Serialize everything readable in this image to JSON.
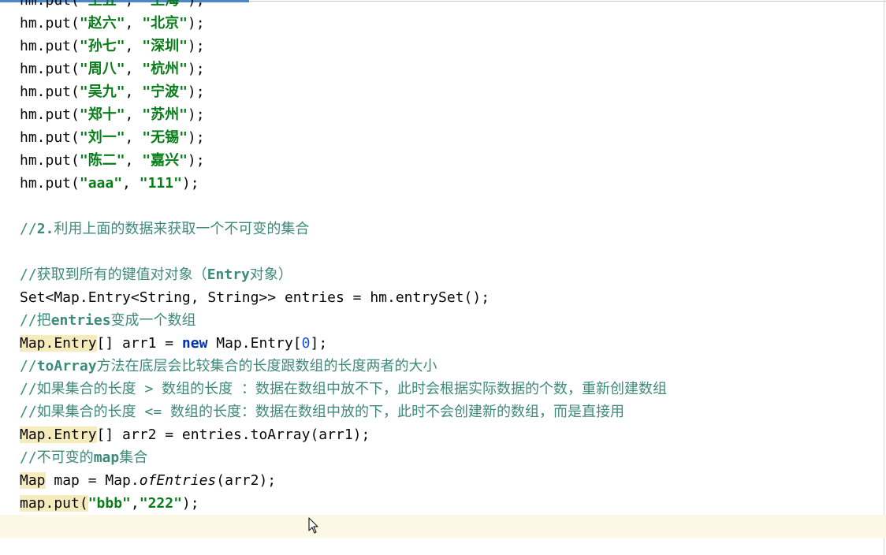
{
  "code_lines": {
    "l0": {
      "pre": "hm.put(",
      "a": "\"王五\"",
      "sep": ", ",
      "b": "\"上海\"",
      "post": ");"
    },
    "l1": {
      "pre": "hm.put(",
      "a": "\"赵六\"",
      "sep": ", ",
      "b": "\"北京\"",
      "post": ");"
    },
    "l2": {
      "pre": "hm.put(",
      "a": "\"孙七\"",
      "sep": ", ",
      "b": "\"深圳\"",
      "post": ");"
    },
    "l3": {
      "pre": "hm.put(",
      "a": "\"周八\"",
      "sep": ", ",
      "b": "\"杭州\"",
      "post": ");"
    },
    "l4": {
      "pre": "hm.put(",
      "a": "\"吴九\"",
      "sep": ", ",
      "b": "\"宁波\"",
      "post": ");"
    },
    "l5": {
      "pre": "hm.put(",
      "a": "\"郑十\"",
      "sep": ", ",
      "b": "\"苏州\"",
      "post": ");"
    },
    "l6": {
      "pre": "hm.put(",
      "a": "\"刘一\"",
      "sep": ", ",
      "b": "\"无锡\"",
      "post": ");"
    },
    "l7": {
      "pre": "hm.put(",
      "a": "\"陈二\"",
      "sep": ", ",
      "b": "\"嘉兴\"",
      "post": ");"
    },
    "l8": {
      "pre": "hm.put(",
      "a": "\"aaa\"",
      "sep": ", ",
      "b": "\"111\"",
      "post": ");"
    },
    "l10": {
      "c1": "//",
      "c2": "2.",
      "c3": "利用上面的数据来获取一个不可变的集合"
    },
    "l12": {
      "c1": "//获取到所有的键值对对象（",
      "c2": "Entry",
      "c3": "对象）"
    },
    "l13": {
      "text": "Set<Map.Entry<String, String>> entries = hm.entrySet();"
    },
    "l14": {
      "c1": "//把",
      "c2": "entries",
      "c3": "变成一个数组"
    },
    "l15": {
      "hl": "Map.Entry",
      "mid": "[] arr1 = ",
      "kw": "new",
      "mid2": " Map.Entry[",
      "num": "0",
      "post": "];"
    },
    "l16": {
      "c1": "//",
      "c2": "toArray",
      "c3": "方法在底层会比较集合的长度跟数组的长度两者的大小"
    },
    "l17": {
      "text": "//如果集合的长度 > 数组的长度 ：数据在数组中放不下，此时会根据实际数据的个数，重新创建数组"
    },
    "l18": {
      "text": "//如果集合的长度 <= 数组的长度：数据在数组中放的下，此时不会创建新的数组，而是直接用"
    },
    "l19": {
      "hl": "Map.Entry",
      "post": "[] arr2 = entries.toArray(arr1);"
    },
    "l20": {
      "c1": "//不可变的",
      "c2": "map",
      "c3": "集合"
    },
    "l21": {
      "hl": "Map",
      "mid": " map = Map.",
      "it": "ofEntries",
      "post": "(arr2);"
    },
    "l22": {
      "hl": "map.put",
      "mid": "(",
      "a": "\"bbb\"",
      "sep": ",",
      "b": "\"222\"",
      "post": ");"
    }
  },
  "colors": {
    "string": "#067d17",
    "comment": "#3d8a7a",
    "keyword": "#0033b3",
    "number": "#1750eb",
    "highlight": "#f6ebbc",
    "current_line": "#fdf8e6",
    "tab_accent": "#4a86c8"
  },
  "icons": {
    "cursor": "mouse-pointer-icon"
  }
}
